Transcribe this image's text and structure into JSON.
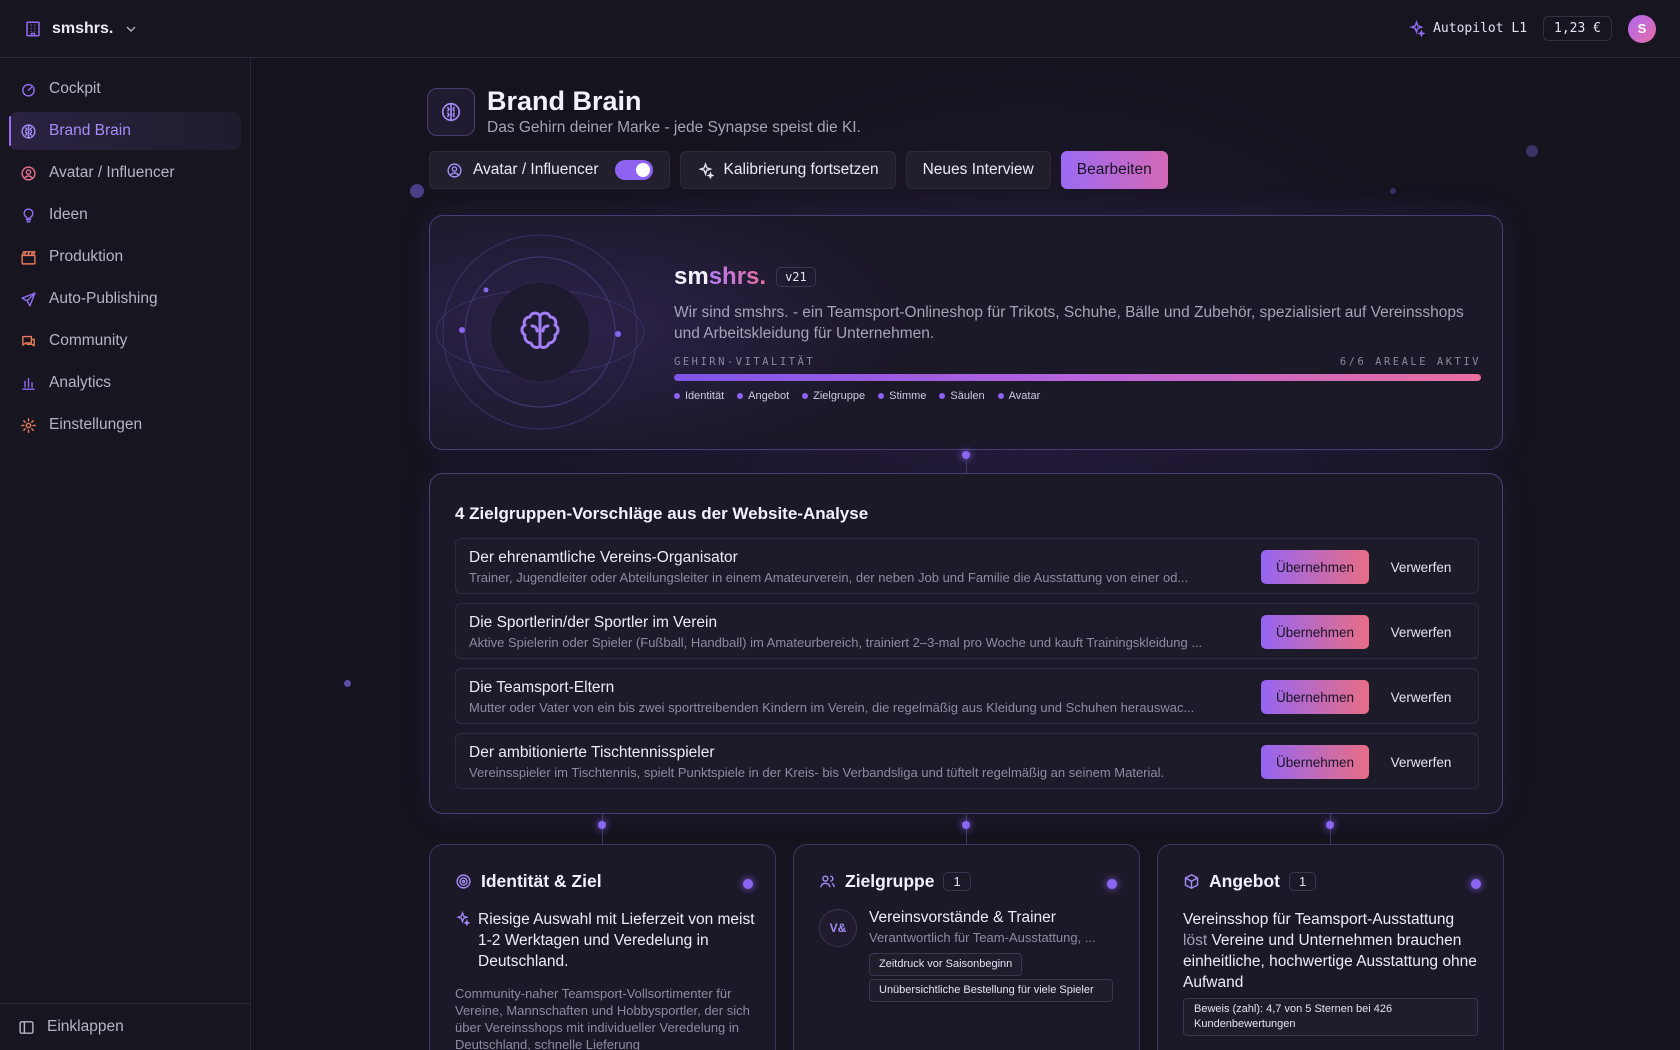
{
  "topbar": {
    "workspace_name": "smshrs.",
    "autopilot_label": "Autopilot L1",
    "cost": "1,23 €",
    "avatar_initial": "S"
  },
  "sidebar": {
    "items": [
      {
        "label": "Cockpit",
        "icon": "gauge-icon",
        "color": "#8f6cf0"
      },
      {
        "label": "Brand Brain",
        "icon": "brain-icon",
        "color": "#a58cf7",
        "active": true
      },
      {
        "label": "Avatar / Influencer",
        "icon": "user-circle-icon",
        "color": "#e46f8e"
      },
      {
        "label": "Ideen",
        "icon": "lightbulb-icon",
        "color": "#8f6cf0"
      },
      {
        "label": "Produktion",
        "icon": "clapperboard-icon",
        "color": "#e67a5c"
      },
      {
        "label": "Auto-Publishing",
        "icon": "send-icon",
        "color": "#8f6cf0"
      },
      {
        "label": "Community",
        "icon": "chat-icon",
        "color": "#e67a5c"
      },
      {
        "label": "Analytics",
        "icon": "bar-chart-icon",
        "color": "#8f6cf0"
      },
      {
        "label": "Einstellungen",
        "icon": "gear-icon",
        "color": "#e67a5c"
      }
    ],
    "collapse_label": "Einklappen"
  },
  "header": {
    "title": "Brand Brain",
    "subtitle": "Das Gehirn deiner Marke - jede Synapse speist die KI."
  },
  "toolbar": {
    "avatar_toggle_label": "Avatar / Influencer",
    "avatar_toggle_on": true,
    "calibrate_label": "Kalibrierung fortsetzen",
    "interview_label": "Neues Interview",
    "edit_label": "Bearbeiten"
  },
  "brain": {
    "brand_prefix": "sm",
    "brand_accent": "shrs.",
    "version": "v21",
    "description": "Wir sind smshrs. - ein Teamsport-Onlineshop für Trikots, Schuhe, Bälle und Zubehör, spezialisiert auf Vereinsshops und Arbeitskleidung für Unternehmen.",
    "vitality_label": "GEHIRN-VITALITÄT",
    "vitality_status": "6/6 AREALE AKTIV",
    "vitality_fraction": 1.0,
    "areas": [
      "Identität",
      "Angebot",
      "Zielgruppe",
      "Stimme",
      "Säulen",
      "Avatar"
    ]
  },
  "suggestions": {
    "title": "4 Zielgruppen-Vorschläge aus der Website-Analyse",
    "accept_label": "Übernehmen",
    "reject_label": "Verwerfen",
    "items": [
      {
        "name": "Der ehrenamtliche Vereins-Organisator",
        "desc": "Trainer, Jugendleiter oder Abteilungsleiter in einem Amateurverein, der neben Job und Familie die Ausstattung von einer od..."
      },
      {
        "name": "Die Sportlerin/der Sportler im Verein",
        "desc": "Aktive Spielerin oder Spieler (Fußball, Handball) im Amateurbereich, trainiert 2–3-mal pro Woche und kauft Trainingskleidung ..."
      },
      {
        "name": "Die Teamsport-Eltern",
        "desc": "Mutter oder Vater von ein bis zwei sporttreibenden Kindern im Verein, die regelmäßig aus Kleidung und Schuhen herauswac..."
      },
      {
        "name": "Der ambitionierte Tischtennisspieler",
        "desc": "Vereinsspieler im Tischtennis, spielt Punktspiele in der Kreis- bis Verbandsliga und tüftelt regelmäßig an seinem Material."
      }
    ]
  },
  "cards": {
    "identity": {
      "title": "Identität & Ziel",
      "claim": "Riesige Auswahl mit Lieferzeit von meist 1-2 Werktagen und Veredelung in Deutschland.",
      "text": "Community-naher Teamsport-Vollsortimenter für Vereine, Mannschaften und Hobbysportler, der sich über Vereinsshops mit individueller Veredelung in Deutschland, schnelle Lieferung"
    },
    "audience": {
      "title": "Zielgruppe",
      "count": "1",
      "initials": "V&",
      "name": "Vereinsvorstände & Trainer",
      "role": "Verantwortlich für Team-Ausstattung, ...",
      "pains": [
        "Zeitdruck vor Saisonbeginn",
        "Unübersichtliche Bestellung für viele Spieler"
      ]
    },
    "offer": {
      "title": "Angebot",
      "count": "1",
      "product": "Vereinsshop für Teamsport-Ausstattung",
      "verb": " löst ",
      "problem": "Vereine und Unternehmen brauchen einheitliche, hochwertige Ausstattung ohne Aufwand",
      "proof": "Beweis (zahl): 4,7 von 5 Sternen bei 426 Kundenbewertungen"
    }
  }
}
